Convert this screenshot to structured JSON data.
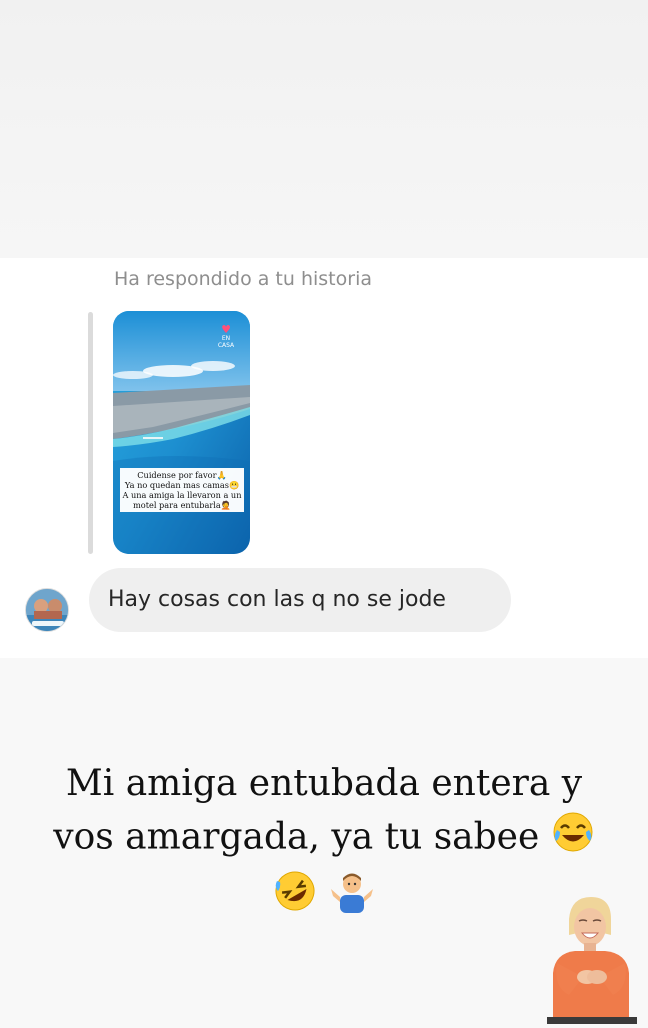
{
  "chat": {
    "reply_label": "Ha respondido a tu historia",
    "story": {
      "logo_text": "EN CASA",
      "caption_lines": [
        "Cuidense por favor🙏",
        "Ya no quedan mas camas😬",
        "A una amiga la llevaron a un",
        "motel para entubarla🤦"
      ]
    },
    "message": "Hay cosas con las q no se jode"
  },
  "overlay": {
    "line1": "Mi amiga entubada entera y",
    "line2": "vos amargada, ya tu sabee"
  },
  "icons": [
    "avatar",
    "joy-emoji",
    "rofl-emoji",
    "shrug-emoji",
    "laughing-woman-sticker"
  ]
}
